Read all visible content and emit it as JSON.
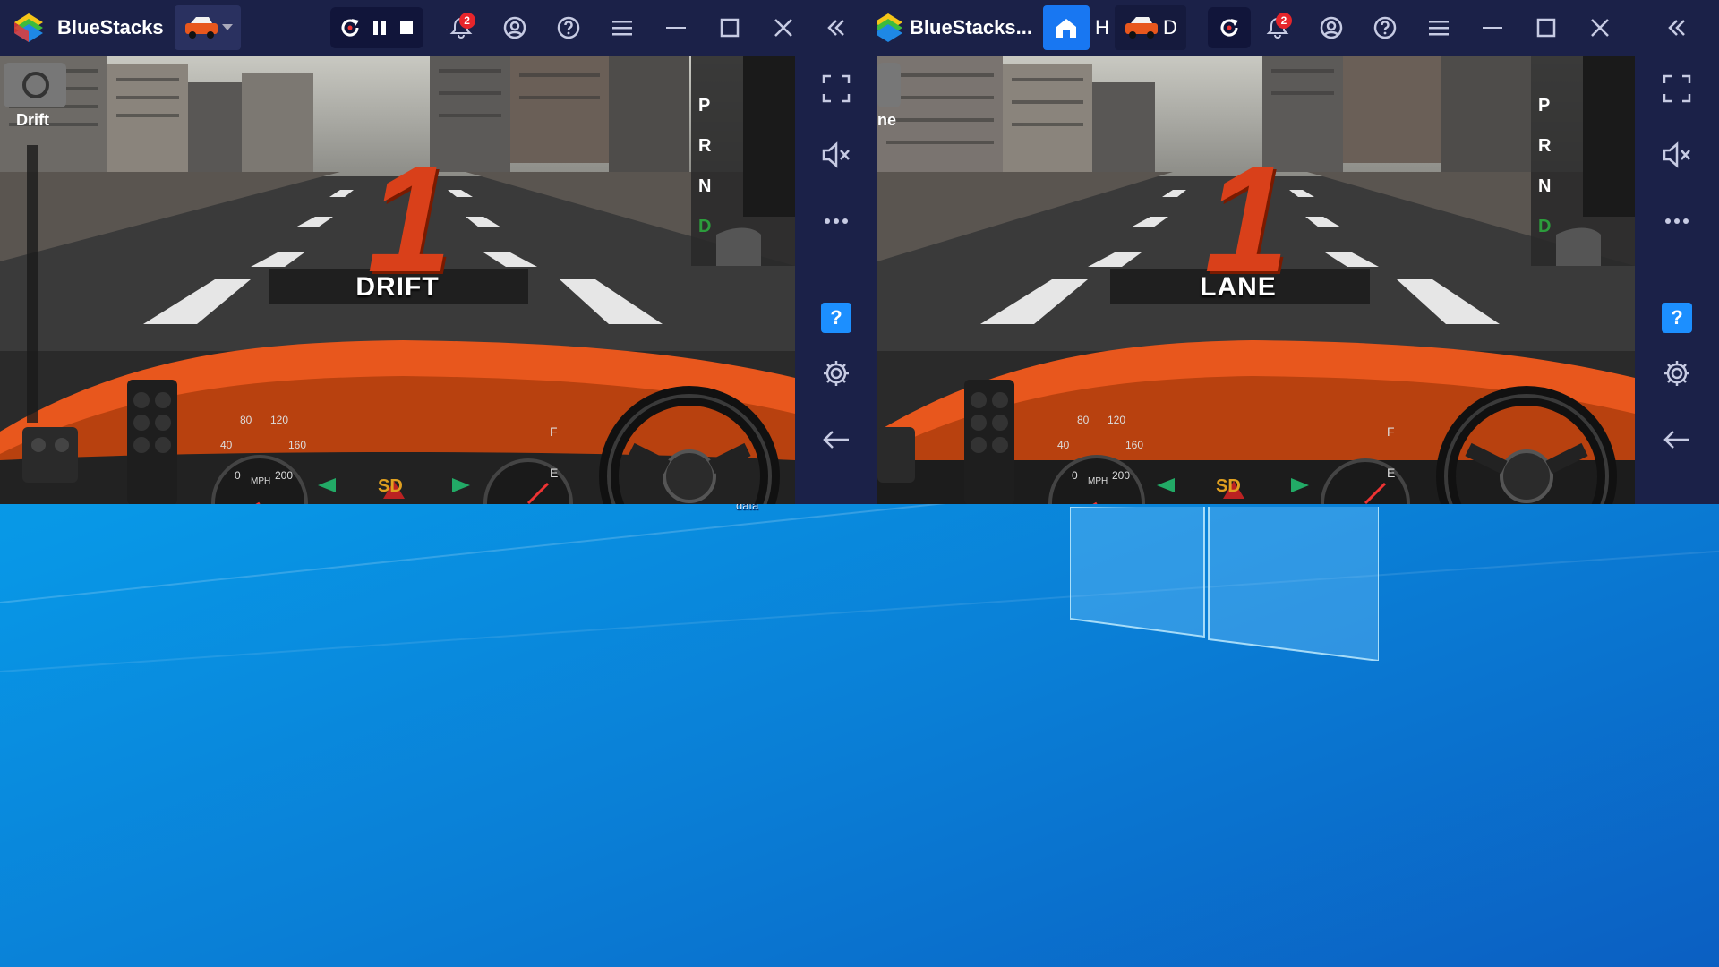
{
  "window_left": {
    "app_title": "BlueStacks",
    "notification_count": "2",
    "game_mode_label": "DRIFT",
    "gear_number": "1",
    "camera_label": "Drift",
    "gears": [
      "P",
      "R",
      "N",
      "D"
    ],
    "speedo_ticks": [
      "80",
      "120",
      "40",
      "160",
      "0",
      "200"
    ],
    "speedo_unit": "MPH",
    "fuel_full": "F",
    "fuel_empty": "E",
    "brand": "SD"
  },
  "window_right": {
    "app_title": "BlueStacks...",
    "notification_count": "2",
    "tab_home_trunc": "H",
    "tab_game_trunc": "D",
    "game_mode_label": "LANE",
    "gear_number": "1",
    "camera_label_trunc": "ne",
    "gears": [
      "P",
      "R",
      "N",
      "D"
    ],
    "speedo_ticks": [
      "80",
      "120",
      "40",
      "160",
      "0",
      "200"
    ],
    "speedo_unit": "MPH",
    "fuel_full": "F",
    "fuel_empty": "E",
    "brand": "SD"
  },
  "desktop": {
    "icon_label": "data"
  },
  "colors": {
    "titlebar": "#1b2148",
    "accent": "#1877f2",
    "car_hood": "#e8571d",
    "desktop_blue": "#0897e6"
  },
  "icons": [
    "bluestacks-logo",
    "car-tab-icon",
    "refresh-icon",
    "pause-icon",
    "stop-icon",
    "bell-icon",
    "account-icon",
    "help-circle-icon",
    "menu-icon",
    "minimize-icon",
    "maximize-icon",
    "close-icon",
    "collapse-icon",
    "fullscreen-icon",
    "mute-icon",
    "more-icon",
    "help-icon",
    "settings-icon",
    "back-icon",
    "home-icon",
    "windows-logo"
  ]
}
